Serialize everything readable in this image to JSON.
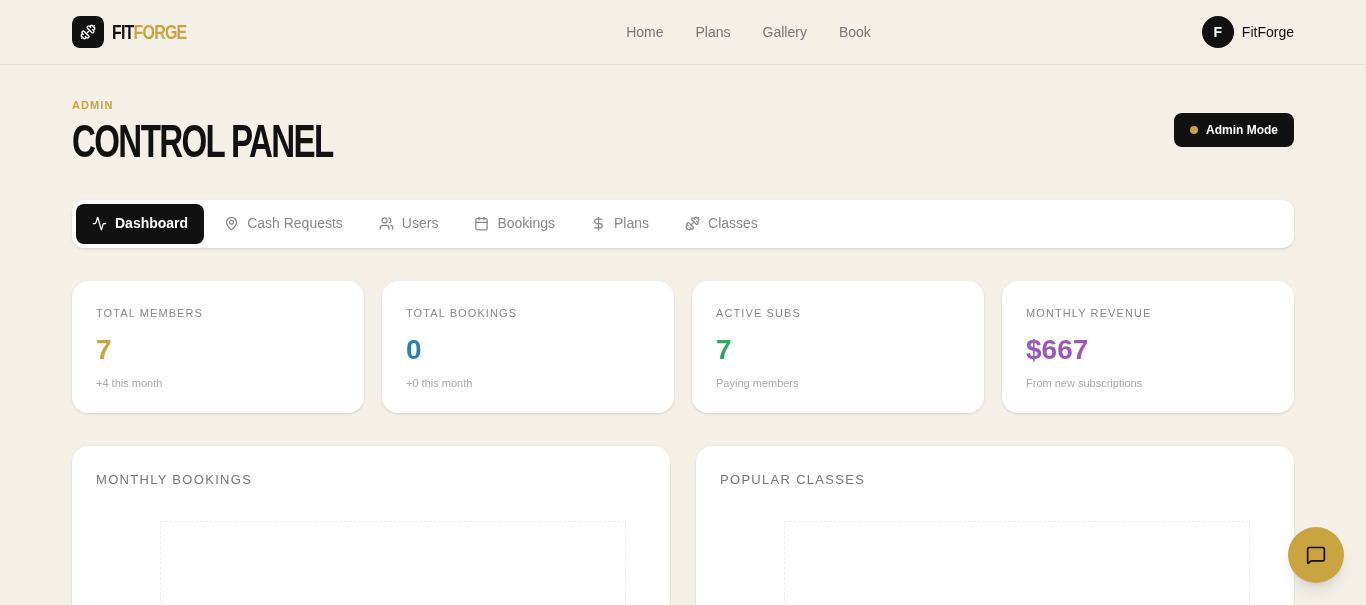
{
  "brand": {
    "part_1": "FIT",
    "part_2": "FORGE"
  },
  "nav": [
    {
      "label": "Home"
    },
    {
      "label": "Plans"
    },
    {
      "label": "Gallery"
    },
    {
      "label": "Book"
    }
  ],
  "user": {
    "initial": "F",
    "name": "FitForge"
  },
  "header": {
    "eyebrow": "ADMIN",
    "title": "CONTROL PANEL",
    "badge": "Admin Mode"
  },
  "tabs": [
    {
      "label": "Dashboard",
      "selected": true
    },
    {
      "label": "Cash Requests",
      "selected": false
    },
    {
      "label": "Users",
      "selected": false
    },
    {
      "label": "Bookings",
      "selected": false
    },
    {
      "label": "Plans",
      "selected": false
    },
    {
      "label": "Classes",
      "selected": false
    }
  ],
  "stats": [
    {
      "label": "TOTAL MEMBERS",
      "value": "7",
      "note": "+4 this month",
      "color": "#c9a441"
    },
    {
      "label": "TOTAL BOOKINGS",
      "value": "0",
      "note": "+0 this month",
      "color": "#2b7fb0"
    },
    {
      "label": "ACTIVE SUBS",
      "value": "7",
      "note": "Paying members",
      "color": "#2fa862"
    },
    {
      "label": "MONTHLY REVENUE",
      "value": "$667",
      "note": "From new subscriptions",
      "color": "#9b59b6"
    }
  ],
  "panels": [
    {
      "title": "MONTHLY BOOKINGS"
    },
    {
      "title": "POPULAR CLASSES"
    }
  ]
}
